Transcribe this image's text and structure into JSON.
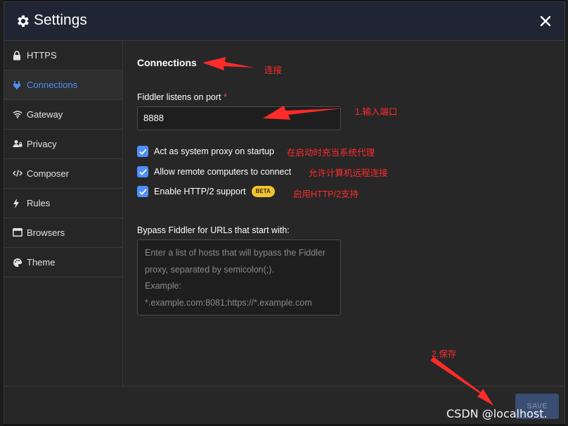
{
  "window": {
    "title": "Settings"
  },
  "sidebar": {
    "items": [
      {
        "label": "HTTPS",
        "icon": "lock-icon",
        "active": false
      },
      {
        "label": "Connections",
        "icon": "plug-icon",
        "active": true
      },
      {
        "label": "Gateway",
        "icon": "wifi-icon",
        "active": false
      },
      {
        "label": "Privacy",
        "icon": "user-lock-icon",
        "active": false
      },
      {
        "label": "Composer",
        "icon": "code-icon",
        "active": false
      },
      {
        "label": "Rules",
        "icon": "bolt-icon",
        "active": false
      },
      {
        "label": "Browsers",
        "icon": "window-icon",
        "active": false
      },
      {
        "label": "Theme",
        "icon": "palette-icon",
        "active": false
      }
    ]
  },
  "content": {
    "section_title": "Connections",
    "port": {
      "label": "Fiddler listens on port",
      "required_mark": "*",
      "value": "8888"
    },
    "options": [
      {
        "label": "Act as system proxy on startup",
        "checked": true
      },
      {
        "label": "Allow remote computers to connect",
        "checked": true
      },
      {
        "label": "Enable HTTP/2 support",
        "checked": true,
        "badge": "BETA"
      }
    ],
    "bypass": {
      "label": "Bypass Fiddler for URLs that start with:",
      "placeholder_lines": [
        "Enter a list of hosts that will bypass the Fiddler",
        "proxy, separated by semicolon(;).",
        "Example:",
        "*.example.com:8081;https://*.example.com"
      ]
    }
  },
  "footer": {
    "save_label": "SAVE"
  },
  "annotations": {
    "connect": "连接",
    "port": "1.输入端口",
    "proxy_startup": "在启动时充当系统代理",
    "remote": "允许计算机远程连接",
    "http2": "启用HTTP/2支持",
    "save": "2.保存"
  },
  "watermark": "CSDN @localhost.",
  "colors": {
    "accent": "#4f8ff7",
    "annotation": "#ff2b2b",
    "beta": "#f2c230",
    "titlebar": "#1f2533"
  }
}
